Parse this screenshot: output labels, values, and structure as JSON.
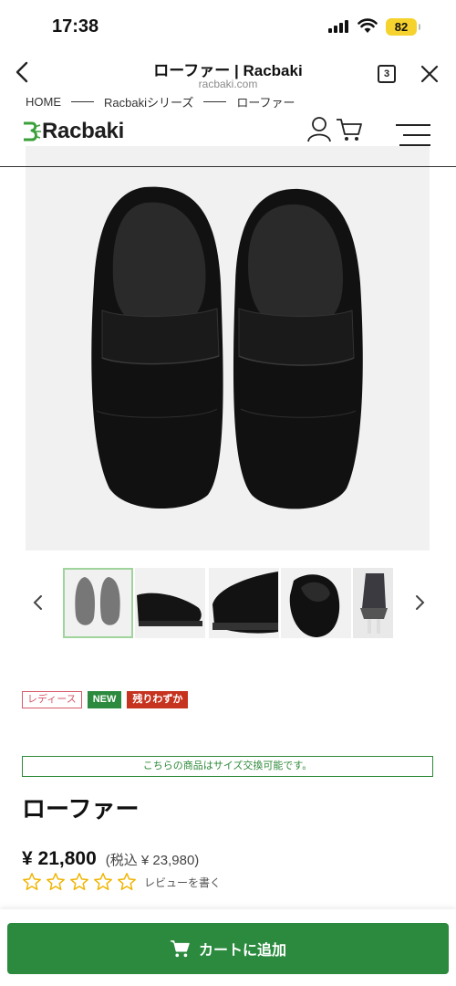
{
  "status_bar": {
    "time": "17:38",
    "battery": "82"
  },
  "browser": {
    "title": "ローファー | Racbaki",
    "url": "racbaki.com",
    "tab_count": "3"
  },
  "breadcrumb": [
    "HOME",
    "Racbakiシリーズ",
    "ローファー"
  ],
  "header": {
    "logo_text": "Racbaki"
  },
  "tags": {
    "ladies": "レディース",
    "new": "NEW",
    "few": "残りわずか"
  },
  "notice": "こちらの商品はサイズ交換可能です。",
  "product": {
    "name": "ローファー",
    "price": "¥ 21,800",
    "tax_price": "(税込 ¥ 23,980)",
    "rating": 0,
    "rating_max": 5,
    "review_link": "レビューを書く"
  },
  "cart_button": "カートに追加",
  "colors": {
    "brand_green": "#2b8a3e",
    "tag_red": "#c6331f",
    "tag_pink": "#d75a6a",
    "star_yellow": "#f0b400"
  }
}
